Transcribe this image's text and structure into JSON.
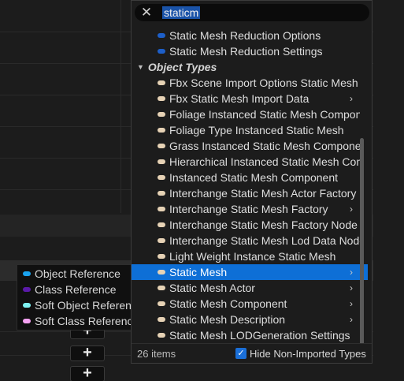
{
  "search": {
    "query": "staticm"
  },
  "list": {
    "top_items": [
      {
        "label": "Static Mesh Reduction Options",
        "color": "#1d5fc9"
      },
      {
        "label": "Static Mesh Reduction Settings",
        "color": "#1d5fc9"
      }
    ],
    "category": "Object Types",
    "object_items": [
      {
        "label": "Fbx Scene Import Options Static Mesh",
        "color": "#e6d2b5",
        "has_submenu": false,
        "selected": false
      },
      {
        "label": "Fbx Static Mesh Import Data",
        "color": "#e6d2b5",
        "has_submenu": true,
        "selected": false
      },
      {
        "label": "Foliage Instanced Static Mesh Component",
        "color": "#e6d2b5",
        "has_submenu": false,
        "selected": false
      },
      {
        "label": "Foliage Type Instanced Static Mesh",
        "color": "#e6d2b5",
        "has_submenu": false,
        "selected": false
      },
      {
        "label": "Grass Instanced Static Mesh Component",
        "color": "#e6d2b5",
        "has_submenu": false,
        "selected": false
      },
      {
        "label": "Hierarchical Instanced Static Mesh Component",
        "color": "#e6d2b5",
        "has_submenu": false,
        "selected": false
      },
      {
        "label": "Instanced Static Mesh Component",
        "color": "#e6d2b5",
        "has_submenu": false,
        "selected": false
      },
      {
        "label": "Interchange Static Mesh Actor Factory",
        "color": "#e6d2b5",
        "has_submenu": false,
        "selected": false
      },
      {
        "label": "Interchange Static Mesh Factory",
        "color": "#e6d2b5",
        "has_submenu": true,
        "selected": false
      },
      {
        "label": "Interchange Static Mesh Factory Node",
        "color": "#e6d2b5",
        "has_submenu": false,
        "selected": false
      },
      {
        "label": "Interchange Static Mesh Lod Data Node",
        "color": "#e6d2b5",
        "has_submenu": false,
        "selected": false
      },
      {
        "label": "Light Weight Instance Static Mesh",
        "color": "#e6d2b5",
        "has_submenu": false,
        "selected": false
      },
      {
        "label": "Static Mesh",
        "color": "#e6d2b5",
        "has_submenu": true,
        "selected": true
      },
      {
        "label": "Static Mesh Actor",
        "color": "#e6d2b5",
        "has_submenu": true,
        "selected": false
      },
      {
        "label": "Static Mesh Component",
        "color": "#e6d2b5",
        "has_submenu": true,
        "selected": false
      },
      {
        "label": "Static Mesh Description",
        "color": "#e6d2b5",
        "has_submenu": true,
        "selected": false
      },
      {
        "label": "Static Mesh LODGeneration Settings",
        "color": "#e6d2b5",
        "has_submenu": false,
        "selected": false
      }
    ]
  },
  "footer": {
    "count": "26 items",
    "hide_label": "Hide Non-Imported Types",
    "hide_checked": true
  },
  "pin_types": [
    {
      "label": "Object Reference",
      "color": "#1aa3ef"
    },
    {
      "label": "Class Reference",
      "color": "#5a1aa8"
    },
    {
      "label": "Soft Object Reference",
      "color": "#7ef2f2"
    },
    {
      "label": "Soft Class Reference",
      "color": "#f5a2f2"
    }
  ],
  "icons": {
    "clear": "close-icon",
    "category": "triangle-down-icon",
    "submenu": "chevron-right-icon",
    "add": "plus-icon",
    "check": "checkmark-icon"
  },
  "glyphs": {
    "clear": "✕",
    "triangle": "▼",
    "chevron": "›",
    "plus": "+",
    "check": "✓"
  }
}
